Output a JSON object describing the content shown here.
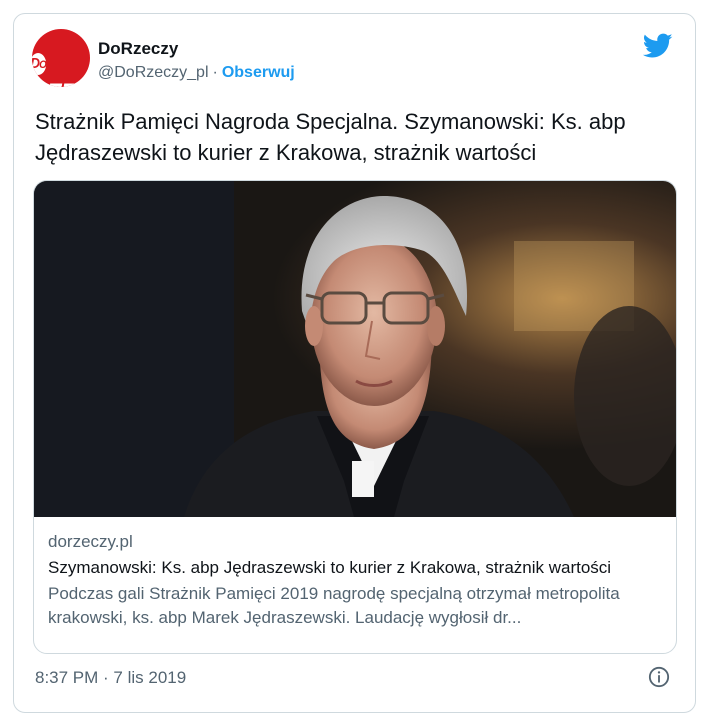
{
  "author": {
    "name": "DoRzeczy",
    "handle": "@DoRzeczy_pl",
    "separator": "·",
    "follow_label": "Obserwuj",
    "avatar_logo_letters": "RZE",
    "avatar_logo_o": "DO"
  },
  "brand_color": "#1d9bf0",
  "tweet": {
    "text": "Strażnik Pamięci Nagroda Specjalna. Szymanowski: Ks. abp Jędraszewski to kurier z Krakowa, strażnik wartości"
  },
  "link_card": {
    "domain": "dorzeczy.pl",
    "title": "Szymanowski: Ks. abp Jędraszewski to kurier z Krakowa, strażnik wartości",
    "description": "Podczas gali Strażnik Pamięci 2019 nagrodę specjalną otrzymał metropolita krakowski, ks. abp Marek Jędraszewski. Laudację wygłosił dr..."
  },
  "timestamp": "8:37 PM · 7 lis 2019",
  "icons": {
    "brand": "twitter-bird-icon",
    "info": "info-icon"
  }
}
